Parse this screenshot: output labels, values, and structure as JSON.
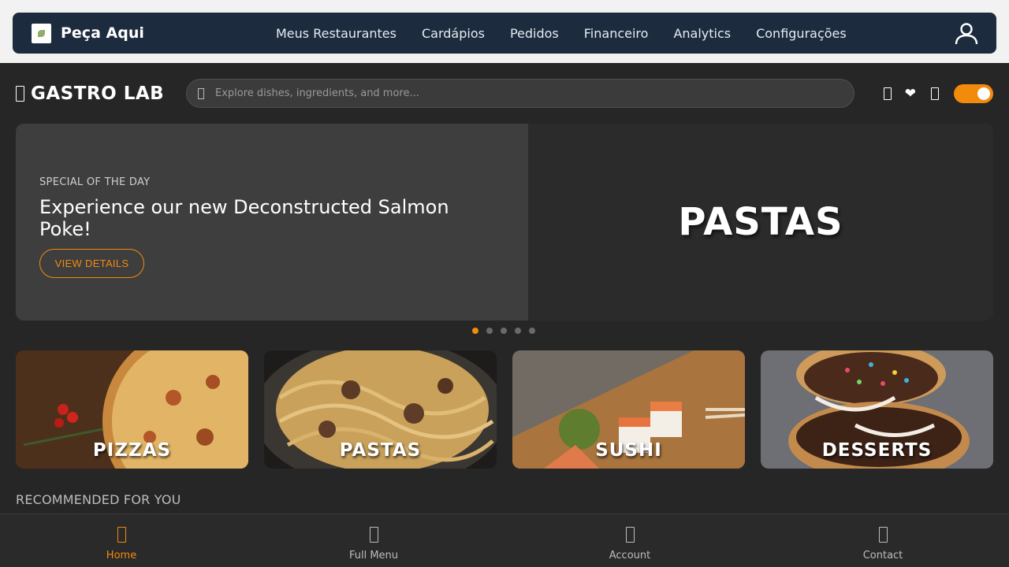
{
  "topbar": {
    "brand_name": "Peça Aqui",
    "nav": [
      "Meus Restaurantes",
      "Cardápios",
      "Pedidos",
      "Financeiro",
      "Analytics",
      "Configurações"
    ]
  },
  "app": {
    "logo_text": "GASTRO LAB",
    "search_placeholder": "Explore dishes, ingredients, and more...",
    "theme_toggle_on": true,
    "accent_color": "#f28a0c"
  },
  "hero": {
    "kicker": "SPECIAL OF THE DAY",
    "title": "Experience our new Deconstructed Salmon Poke!",
    "button_label": "VIEW DETAILS",
    "slide_label": "PASTAS",
    "slide_count": 5,
    "active_slide": 1
  },
  "categories": [
    {
      "label": "PIZZAS"
    },
    {
      "label": "PASTAS"
    },
    {
      "label": "SUSHI"
    },
    {
      "label": "DESSERTS"
    }
  ],
  "sections": {
    "recommended_title": "RECOMMENDED FOR YOU"
  },
  "bottom_nav": [
    {
      "label": "Home",
      "active": true
    },
    {
      "label": "Full Menu",
      "active": false
    },
    {
      "label": "Account",
      "active": false
    },
    {
      "label": "Contact",
      "active": false
    }
  ]
}
